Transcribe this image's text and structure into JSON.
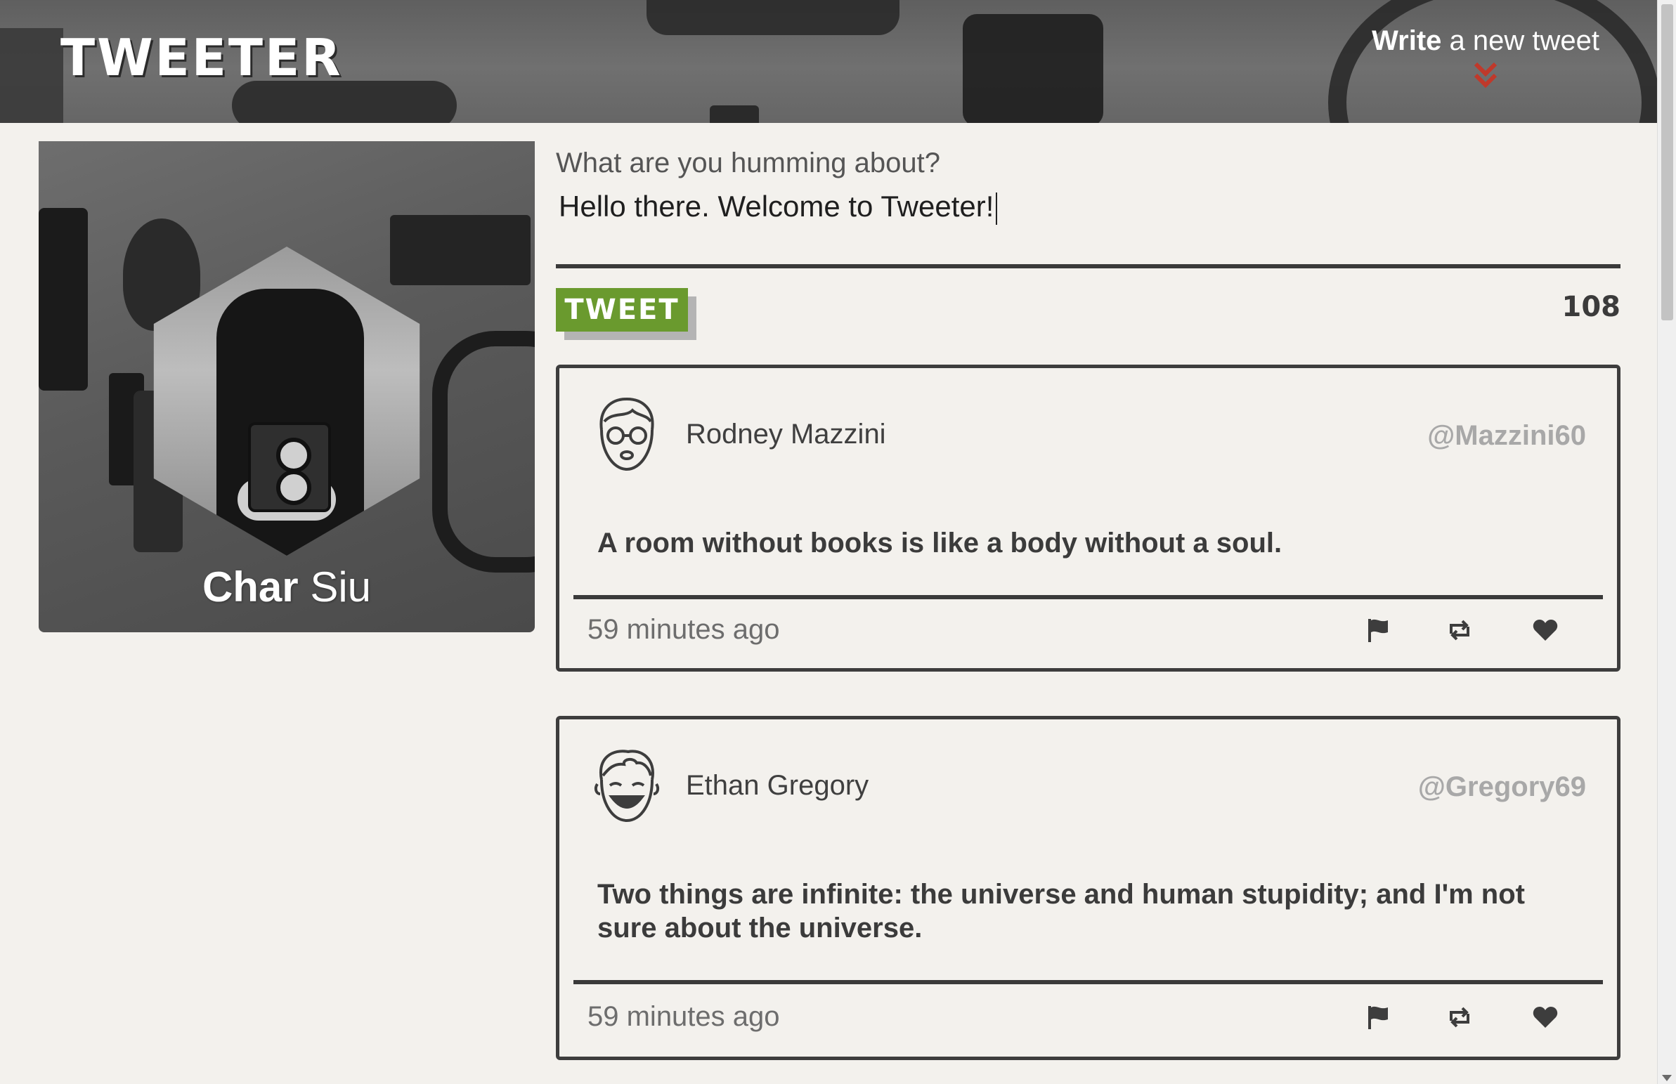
{
  "header": {
    "logo": "TWEETER",
    "compose_toggle": {
      "bold": "Write",
      "rest": " a new tweet"
    },
    "accent_color": "#c0392b"
  },
  "profile": {
    "first_name": "Char",
    "last_name": " Siu"
  },
  "compose": {
    "label": "What are you humming about?",
    "value": "Hello there. Welcome to Tweeter!",
    "button_label": "TWEET",
    "button_color": "#6a9a2e",
    "counter": "108"
  },
  "tweets": [
    {
      "name": "Rodney Mazzini",
      "handle": "@Mazzini60",
      "content": "A room without books is like a body without a soul.",
      "time": "59 minutes ago",
      "avatar_icon": "glasses-face-icon"
    },
    {
      "name": "Ethan Gregory",
      "handle": "@Gregory69",
      "content": "Two things are infinite: the universe and human stupidity; and I'm not sure about the universe.",
      "time": "59 minutes ago",
      "avatar_icon": "laughing-face-icon"
    }
  ]
}
